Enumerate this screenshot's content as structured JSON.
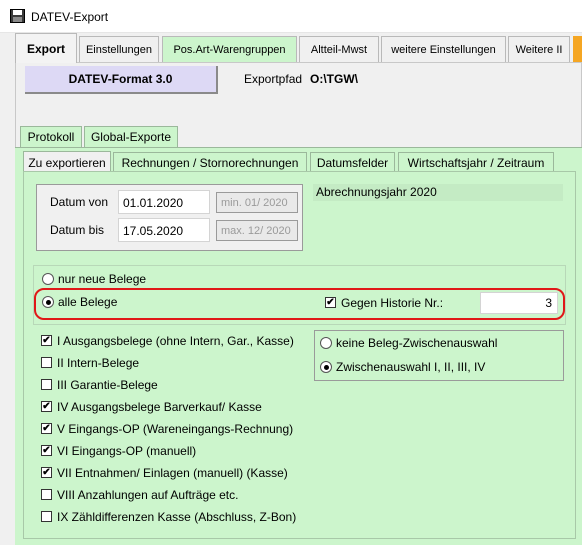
{
  "window": {
    "title": "DATEV-Export"
  },
  "main_tabs": [
    {
      "label": "Export"
    },
    {
      "label": "Einstellungen"
    },
    {
      "label": "Pos.Art-Warengruppen"
    },
    {
      "label": "Altteil-Mwst"
    },
    {
      "label": "weitere Einstellungen"
    },
    {
      "label": "Weitere II"
    }
  ],
  "format_button": {
    "label": "DATEV-Format 3.0"
  },
  "exportpfad": {
    "label": "Exportpfad",
    "value": "O:\\TGW\\"
  },
  "group_tabs": [
    {
      "label": "Protokoll"
    },
    {
      "label": "Global-Exporte"
    }
  ],
  "sub_tabs": [
    {
      "label": "Zu exportieren"
    },
    {
      "label": "Rechnungen / Stornorechnungen"
    },
    {
      "label": "Datumsfelder"
    },
    {
      "label": "Wirtschaftsjahr / Zeitraum"
    }
  ],
  "dates": {
    "von_label": "Datum von",
    "von_value": "01.01.2020",
    "von_hint": "min. 01/ 2020",
    "bis_label": "Datum bis",
    "bis_value": "17.05.2020",
    "bis_hint": "max. 12/ 2020"
  },
  "abrechnungsjahr": "Abrechnungsjahr 2020",
  "belege_mode": {
    "option_new": "nur neue Belege",
    "option_all": "alle Belege",
    "selected": "all"
  },
  "historie": {
    "label": "Gegen Historie Nr.:",
    "checked": true,
    "value": "3"
  },
  "beleg_types": [
    {
      "label": "I Ausgangsbelege (ohne Intern, Gar., Kasse)",
      "checked": true
    },
    {
      "label": "II Intern-Belege",
      "checked": false
    },
    {
      "label": "III Garantie-Belege",
      "checked": false
    },
    {
      "label": "IV Ausgangsbelege Barverkauf/ Kasse",
      "checked": true
    },
    {
      "label": "V Eingangs-OP (Wareneingangs-Rechnung)",
      "checked": true
    },
    {
      "label": "VI Eingangs-OP (manuell)",
      "checked": true
    },
    {
      "label": "VII Entnahmen/ Einlagen (manuell) (Kasse)",
      "checked": true
    },
    {
      "label": "VIII Anzahlungen auf Aufträge etc.",
      "checked": false
    },
    {
      "label": "IX Zähldifferenzen Kasse (Abschluss, Z-Bon)",
      "checked": false
    }
  ],
  "zwischenauswahl": {
    "option_none": "keine Beleg-Zwischenauswahl",
    "option_zw": "Zwischenauswahl I, II, III, IV",
    "selected": "zw"
  },
  "icons": {
    "window": "floppy-disk-icon"
  }
}
